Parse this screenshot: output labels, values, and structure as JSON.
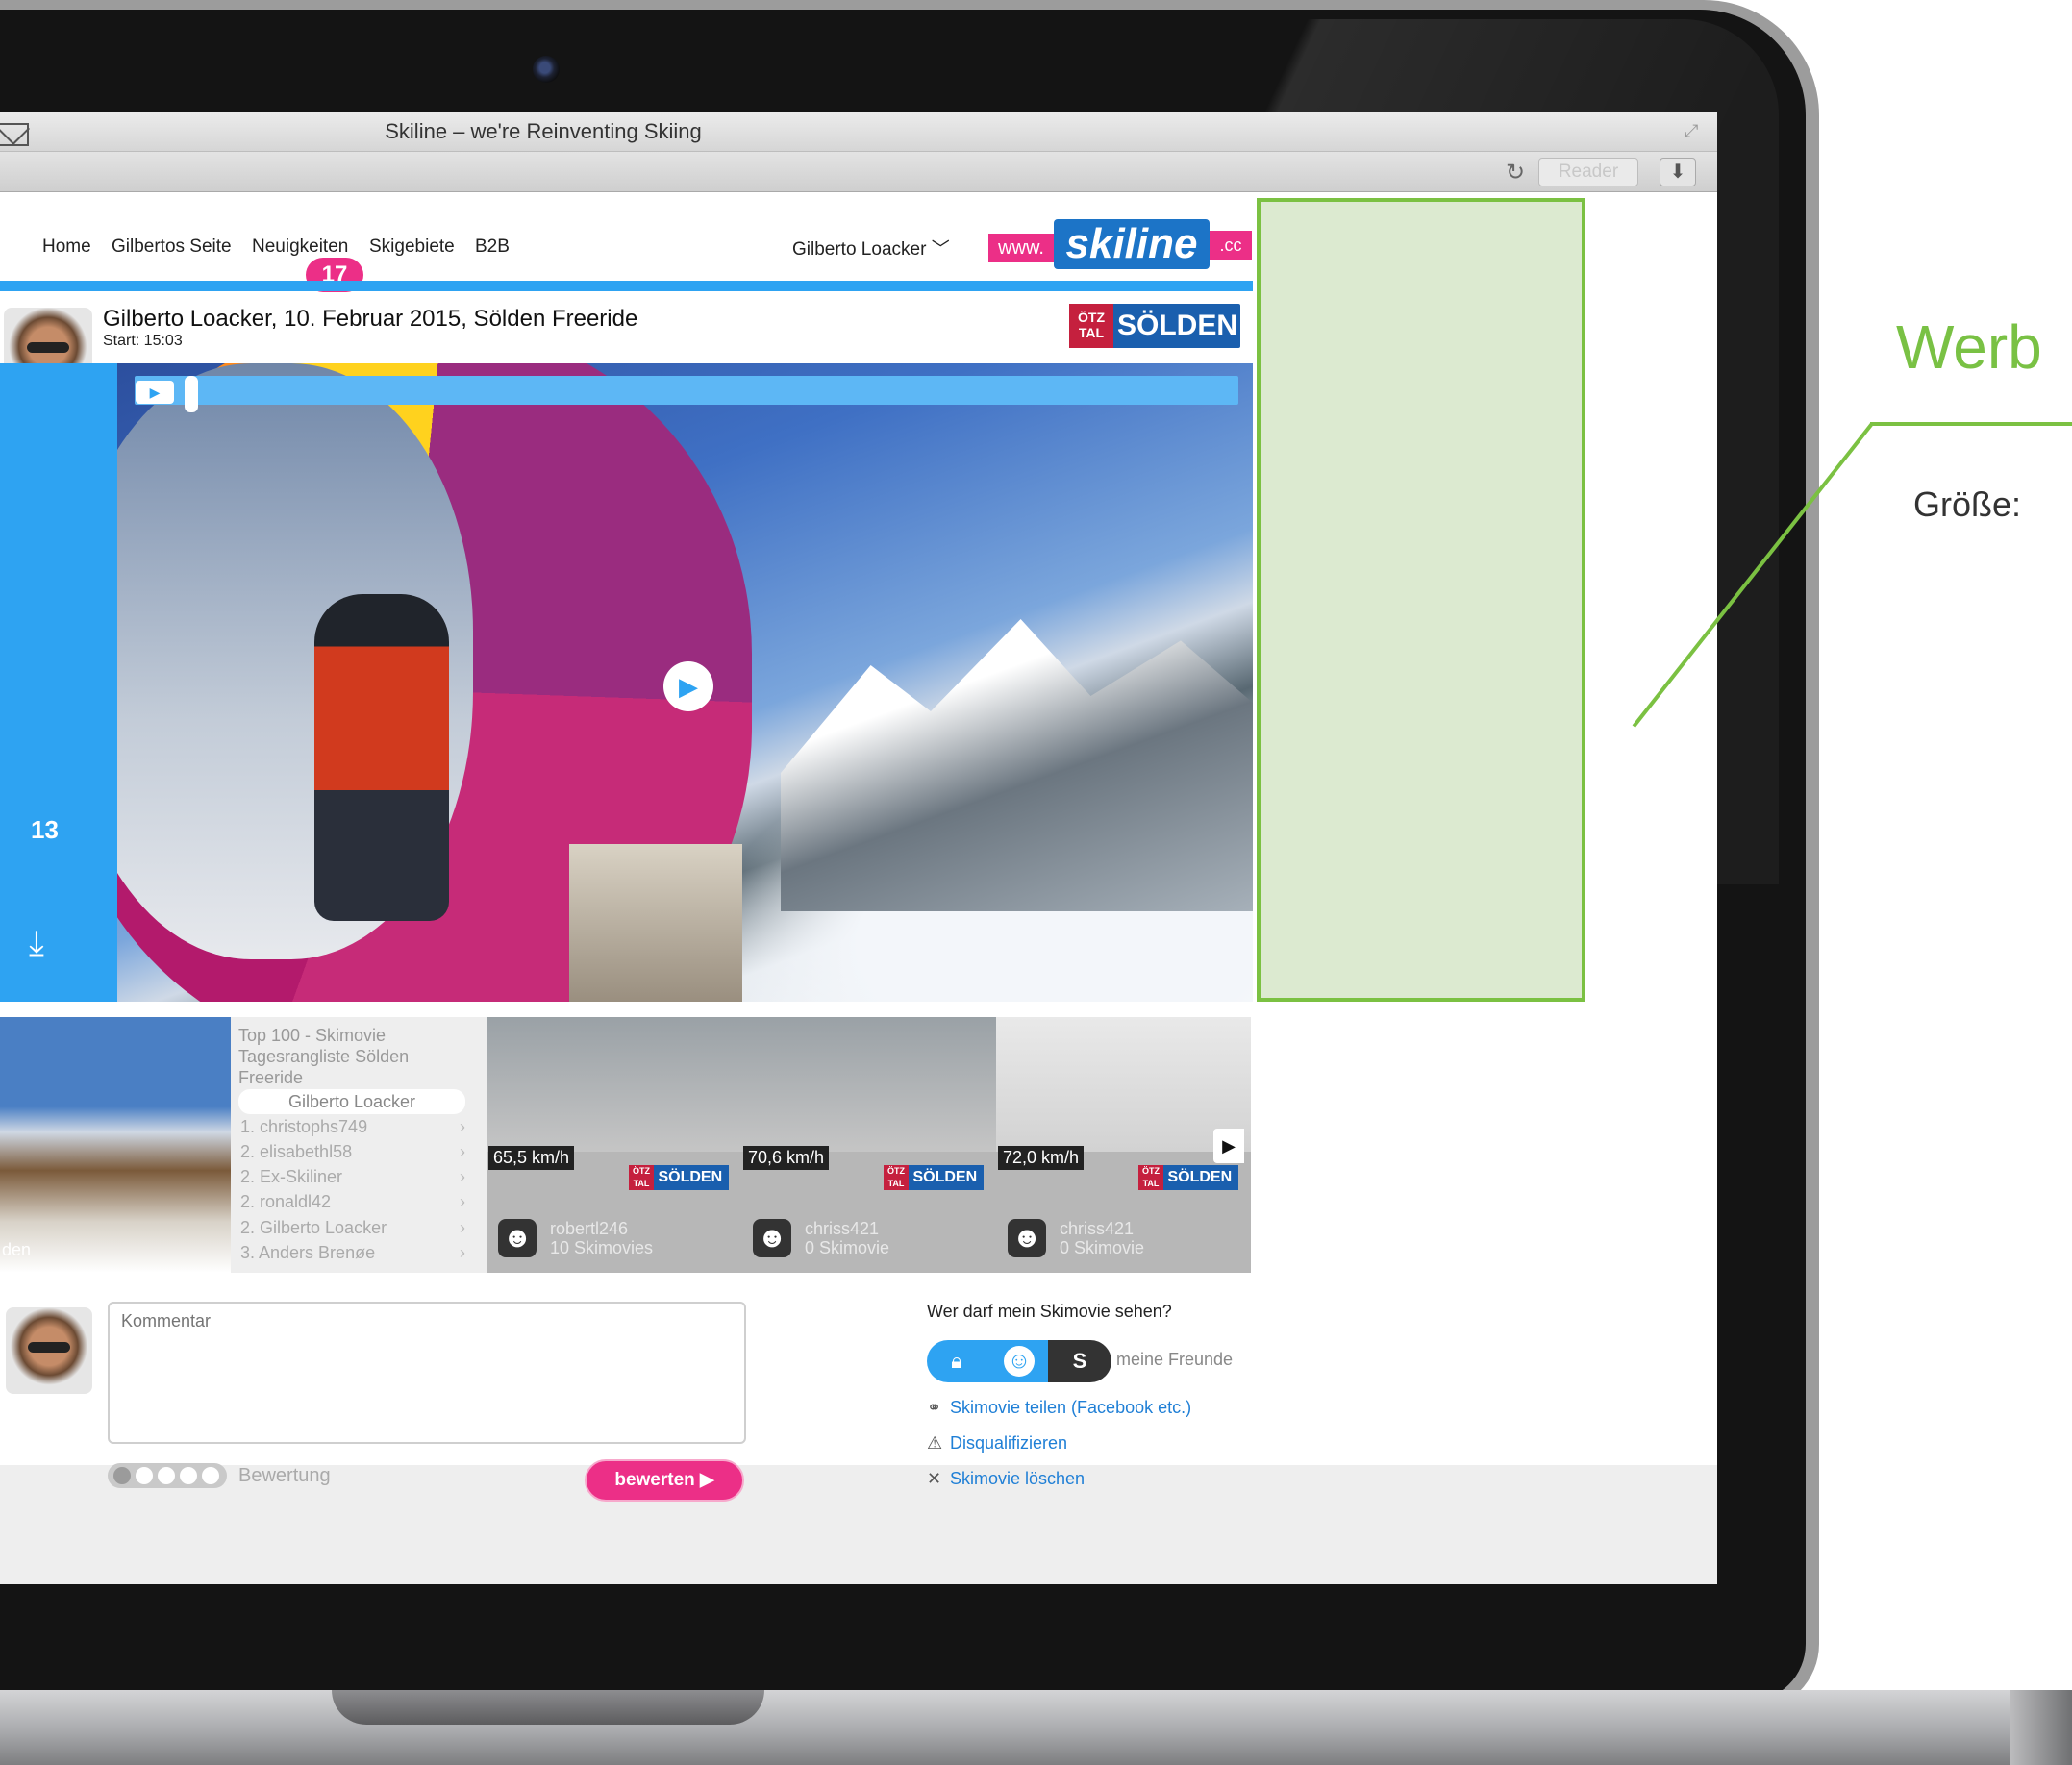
{
  "window": {
    "title": "Skiline – we're Reinventing Skiing",
    "reader_label": "Reader"
  },
  "nav": {
    "items": [
      "Home",
      "Gilbertos Seite",
      "Neuigkeiten",
      "Skigebiete",
      "B2B"
    ],
    "badge_count": "17",
    "user_menu": "Gilberto Loacker",
    "logo": {
      "www": "www.",
      "main": "skiline",
      "cc": ".cc"
    }
  },
  "movie": {
    "title": "Gilberto Loacker, 10. Februar 2015, Sölden Freeride",
    "start": "Start: 15:03",
    "brand": {
      "oetz": "ÖTZ TAL",
      "name": "SÖLDEN"
    },
    "count": "13"
  },
  "strip": {
    "image_label": "den",
    "list_header": "Top 100 - Skimovie Tagesrangliste Sölden Freeride",
    "highlight": "Gilberto Loacker",
    "rows": [
      "1. christophs749",
      "2. elisabethl58",
      "2. Ex-Skiliner",
      "2. ronaldl42",
      "2. Gilberto Loacker",
      "3. Anders Brenøe"
    ],
    "thumbs": [
      {
        "speed": "65,5 km/h",
        "user": "robertl246",
        "movies": "10 Skimovies"
      },
      {
        "speed": "70,6 km/h",
        "user": "chriss421",
        "movies": "0 Skimovie"
      },
      {
        "speed": "72,0 km/h",
        "user": "chriss421",
        "movies": "0 Skimovie"
      }
    ]
  },
  "comment": {
    "placeholder": "Kommentar",
    "rating_label": "Bewertung",
    "submit_label": "bewerten"
  },
  "privacy": {
    "question": "Wer darf mein Skimovie sehen?",
    "selection": "meine Freunde",
    "actions": [
      "Skimovie teilen (Facebook etc.)",
      "Disqualifizieren",
      "Skimovie löschen"
    ]
  },
  "ad": {
    "title": "Werb",
    "size_label": "Größe:"
  },
  "colors": {
    "skiline_blue": "#2ea3f2",
    "skiline_pink": "#ec2f87",
    "ad_green": "#7bc142"
  }
}
